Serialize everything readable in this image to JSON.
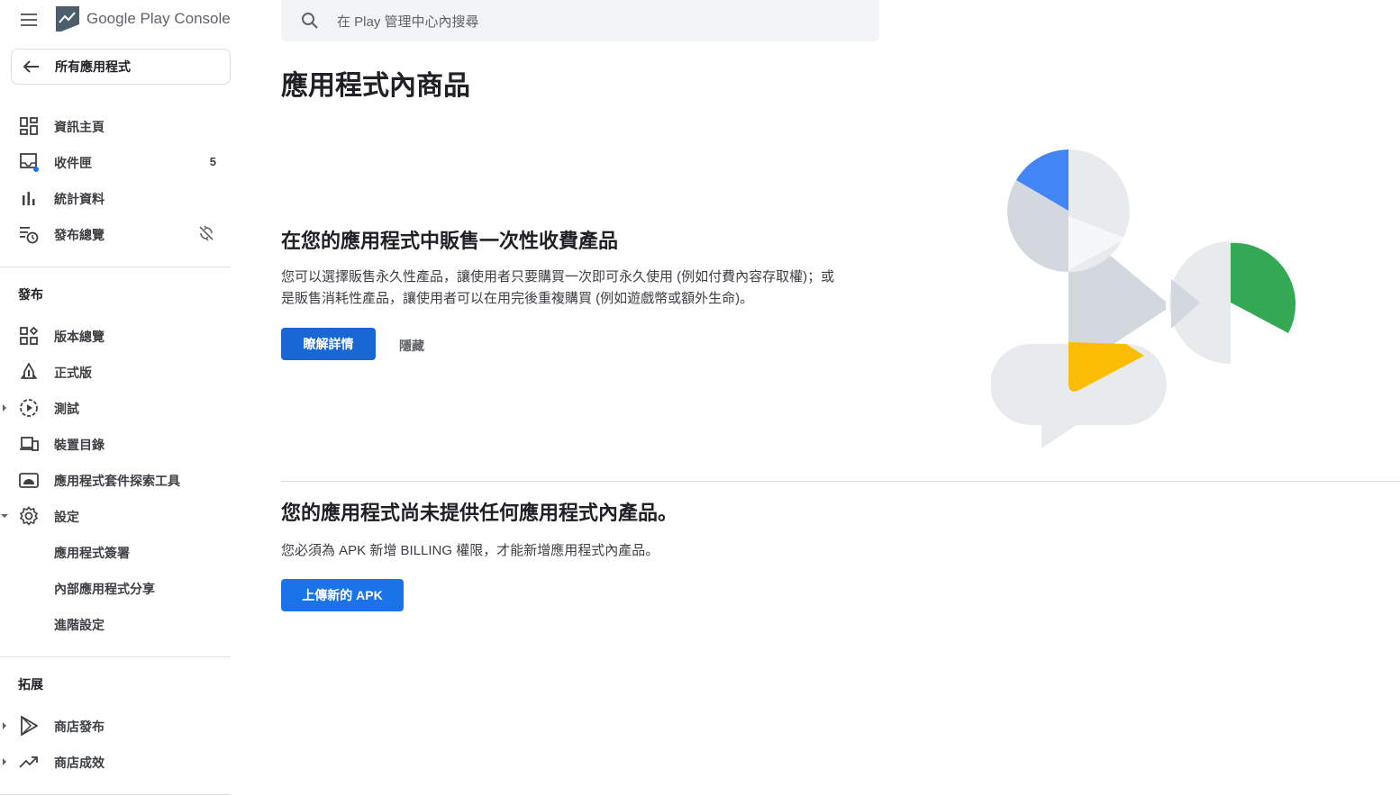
{
  "app": {
    "logo_text": "Google Play Console"
  },
  "search": {
    "placeholder": "在 Play 管理中心內搜尋"
  },
  "sidebar": {
    "back_label": "所有應用程式",
    "items": [
      {
        "label": "資訊主頁"
      },
      {
        "label": "收件匣",
        "badge": "5"
      },
      {
        "label": "統計資料"
      },
      {
        "label": "發布總覽"
      }
    ],
    "sections": [
      {
        "title": "發布",
        "items": [
          {
            "label": "版本總覽"
          },
          {
            "label": "正式版"
          },
          {
            "label": "測試"
          },
          {
            "label": "裝置目錄"
          },
          {
            "label": "應用程式套件探索工具"
          },
          {
            "label": "設定"
          },
          {
            "label": "應用程式簽署"
          },
          {
            "label": "內部應用程式分享"
          },
          {
            "label": "進階設定"
          }
        ]
      },
      {
        "title": "拓展",
        "items": [
          {
            "label": "商店發布"
          },
          {
            "label": "商店成效"
          }
        ]
      }
    ]
  },
  "main": {
    "page_title": "應用程式內商品",
    "promo": {
      "title": "在您的應用程式中販售一次性收費產品",
      "description": "您可以選擇販售永久性產品，讓使用者只要購買一次即可永久使用 (例如付費內容存取權)；或是販售消耗性產品，讓使用者可以在用完後重複購買 (例如遊戲幣或額外生命)。",
      "learn_more": "瞭解詳情",
      "hide": "隱藏"
    },
    "empty": {
      "title": "您的應用程式尚未提供任何應用程式內產品。",
      "description": "您必須為 APK 新增 BILLING 權限，才能新增應用程式內產品。",
      "upload_button": "上傳新的 APK"
    }
  },
  "colors": {
    "accent": "#1a73e8",
    "primary_dark": "#1967d2",
    "green": "#34a853",
    "yellow": "#fbbc04",
    "blue": "#4285f4",
    "gray": "#dadce0"
  }
}
